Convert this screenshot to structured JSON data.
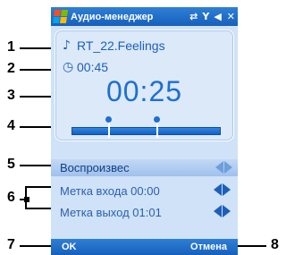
{
  "callouts": [
    "1",
    "2",
    "3",
    "4",
    "5",
    "6",
    "7",
    "8"
  ],
  "titlebar": {
    "title": "Аудио-менеджер",
    "icons": [
      "sync-icon",
      "signal-icon",
      "volume-icon",
      "close-icon"
    ]
  },
  "track": {
    "name": "RT_22.Feelings",
    "duration": "00:45",
    "elapsed": "00:25"
  },
  "progress": {
    "marker_in": 0.24,
    "marker_out": 0.56
  },
  "controls": {
    "mode": "Воспроизвес",
    "marker_in_label": "Метка входа 00:00",
    "marker_out_label": "Метка выход 01:01"
  },
  "softkeys": {
    "left": "OK",
    "right": "Отмена"
  },
  "colors": {
    "titlebar": "#1b6ac9",
    "accent": "#1d6fd0",
    "screen_bg": "#cfe2f7"
  }
}
